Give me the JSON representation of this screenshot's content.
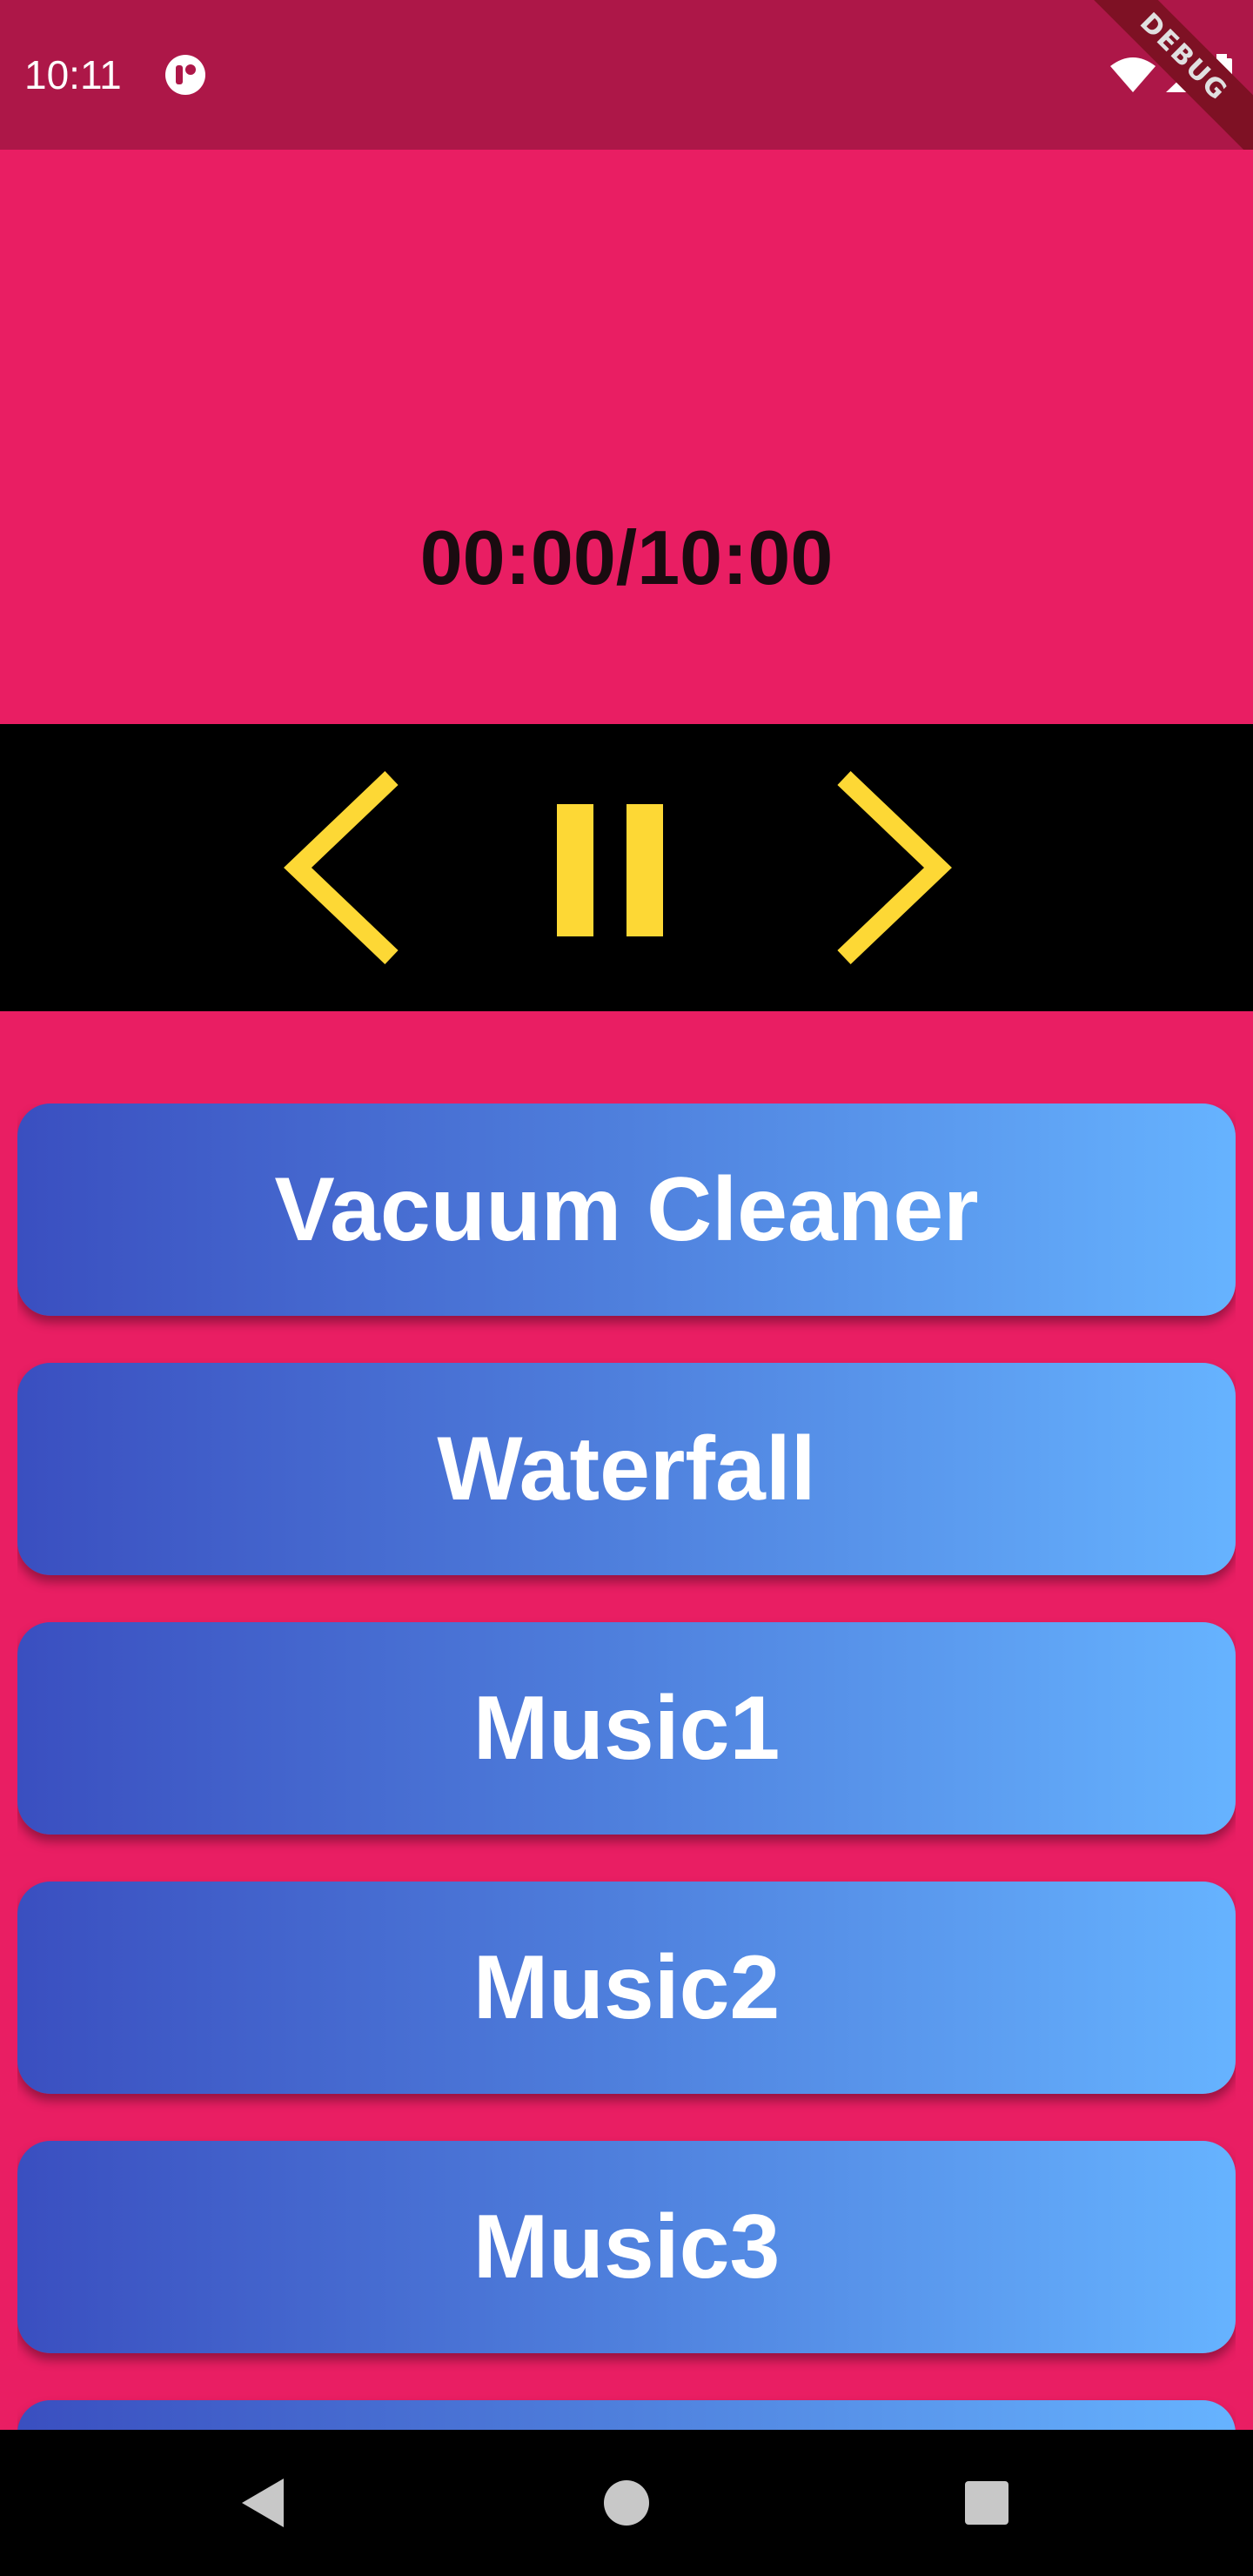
{
  "status_bar": {
    "time": "10:11",
    "debug_label": "DEBUG",
    "icons": [
      "app-notification-icon",
      "wifi-icon",
      "signal-icon",
      "battery-icon"
    ]
  },
  "player": {
    "timer_text": "00:00/10:00",
    "controls": {
      "previous_icon": "chevron-left-icon",
      "pause_icon": "pause-icon",
      "next_icon": "chevron-right-icon"
    }
  },
  "tracks": [
    {
      "label": "Vacuum Cleaner"
    },
    {
      "label": "Waterfall"
    },
    {
      "label": "Music1"
    },
    {
      "label": "Music2"
    },
    {
      "label": "Music3"
    },
    {
      "label": ""
    }
  ],
  "nav_bar": {
    "icons": [
      "back-triangle-icon",
      "home-circle-icon",
      "recents-square-icon"
    ]
  },
  "colors": {
    "accent": "#e91e63",
    "status_bar": "#ad1748",
    "control_icons": "#fdd835",
    "gradient_start": "#3a4fc0",
    "gradient_end": "#66b3ff"
  }
}
